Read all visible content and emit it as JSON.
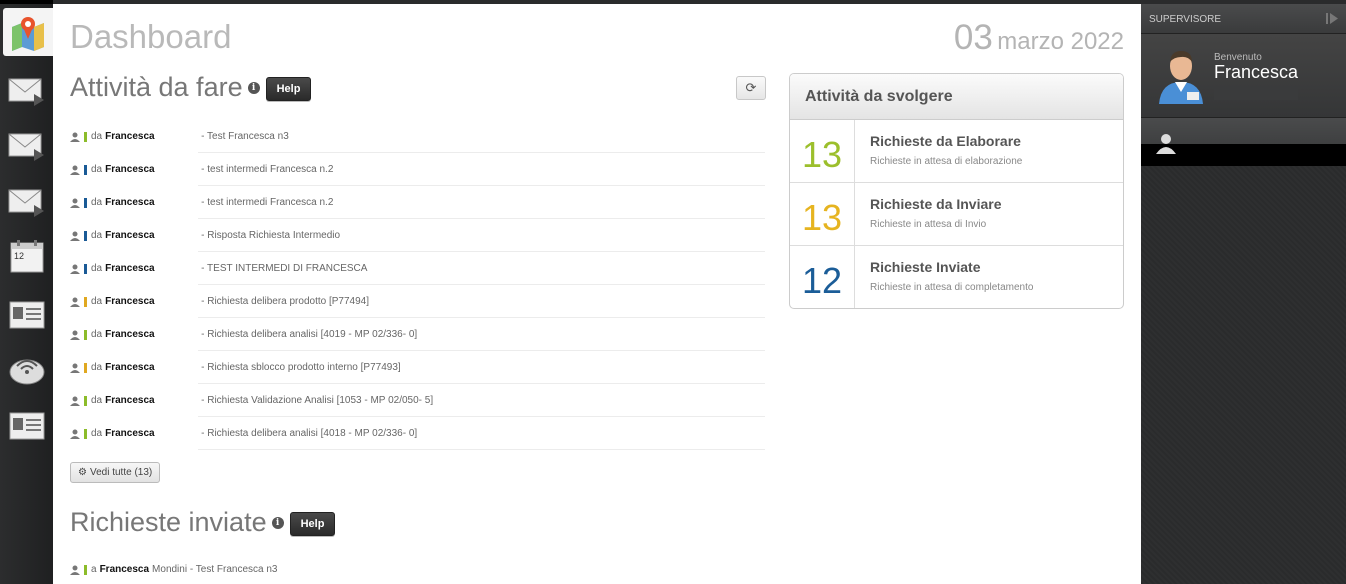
{
  "header": {
    "title": "Dashboard",
    "date_day": "03",
    "date_month_year": "marzo 2022"
  },
  "rail": {
    "items": [
      {
        "icon": "map-icon",
        "active": true
      },
      {
        "icon": "mail-icon",
        "active": false
      },
      {
        "icon": "mail-icon",
        "active": false
      },
      {
        "icon": "mail-icon",
        "active": false
      },
      {
        "icon": "calendar-icon",
        "active": false,
        "text": "12"
      },
      {
        "icon": "id-card-icon",
        "active": false
      },
      {
        "icon": "wifi-device-icon",
        "active": false
      },
      {
        "icon": "id-card-icon",
        "active": false
      }
    ]
  },
  "tasks": {
    "title": "Attività da fare",
    "help_label": "Help",
    "refresh_icon": "refresh-icon",
    "items": [
      {
        "prefix": "da",
        "from": "Francesca",
        "subject": "- Test Francesca n3",
        "color": "#8cbc2a"
      },
      {
        "prefix": "da",
        "from": "Francesca",
        "subject": "- test intermedi Francesca n.2",
        "color": "#1a5a96"
      },
      {
        "prefix": "da",
        "from": "Francesca",
        "subject": "- test intermedi Francesca n.2",
        "color": "#1a5a96"
      },
      {
        "prefix": "da",
        "from": "Francesca",
        "subject": "- Risposta Richiesta Intermedio",
        "color": "#1a5a96"
      },
      {
        "prefix": "da",
        "from": "Francesca",
        "subject": "- TEST INTERMEDI DI FRANCESCA",
        "color": "#1a5a96"
      },
      {
        "prefix": "da",
        "from": "Francesca",
        "subject": "- Richiesta delibera prodotto [P77494]",
        "color": "#e0a820"
      },
      {
        "prefix": "da",
        "from": "Francesca",
        "subject": "- Richiesta delibera analisi [4019 - MP 02/336- 0]",
        "color": "#8cbc2a"
      },
      {
        "prefix": "da",
        "from": "Francesca",
        "subject": "- Richiesta sblocco prodotto interno [P77493]",
        "color": "#e0a820"
      },
      {
        "prefix": "da",
        "from": "Francesca",
        "subject": "- Richiesta Validazione Analisi [1053 - MP 02/050- 5]",
        "color": "#8cbc2a"
      },
      {
        "prefix": "da",
        "from": "Francesca",
        "subject": "- Richiesta delibera analisi [4018 - MP 02/336- 0]",
        "color": "#8cbc2a"
      }
    ],
    "see_all_label": "Vedi tutte (13)"
  },
  "sent": {
    "title": "Richieste inviate",
    "help_label": "Help",
    "first_row": {
      "prefix": "a",
      "to": "Francesca",
      "rest": "Mondini - Test Francesca n3",
      "color": "#8cbc2a"
    }
  },
  "panel": {
    "title": "Attività da svolgere",
    "stats": [
      {
        "value": "13",
        "label": "Richieste da Elaborare",
        "sub": "Richieste in attesa di elaborazione",
        "color": "#9cbf2c"
      },
      {
        "value": "13",
        "label": "Richieste da Inviare",
        "sub": "Richieste in attesa di Invio",
        "color": "#e6b420"
      },
      {
        "value": "12",
        "label": "Richieste Inviate",
        "sub": "Richieste in attesa di completamento",
        "color": "#1b5d98"
      }
    ]
  },
  "sidebar": {
    "role": "SUPERVISORE",
    "welcome": "Benvenuto",
    "user_name": "Francesca"
  }
}
